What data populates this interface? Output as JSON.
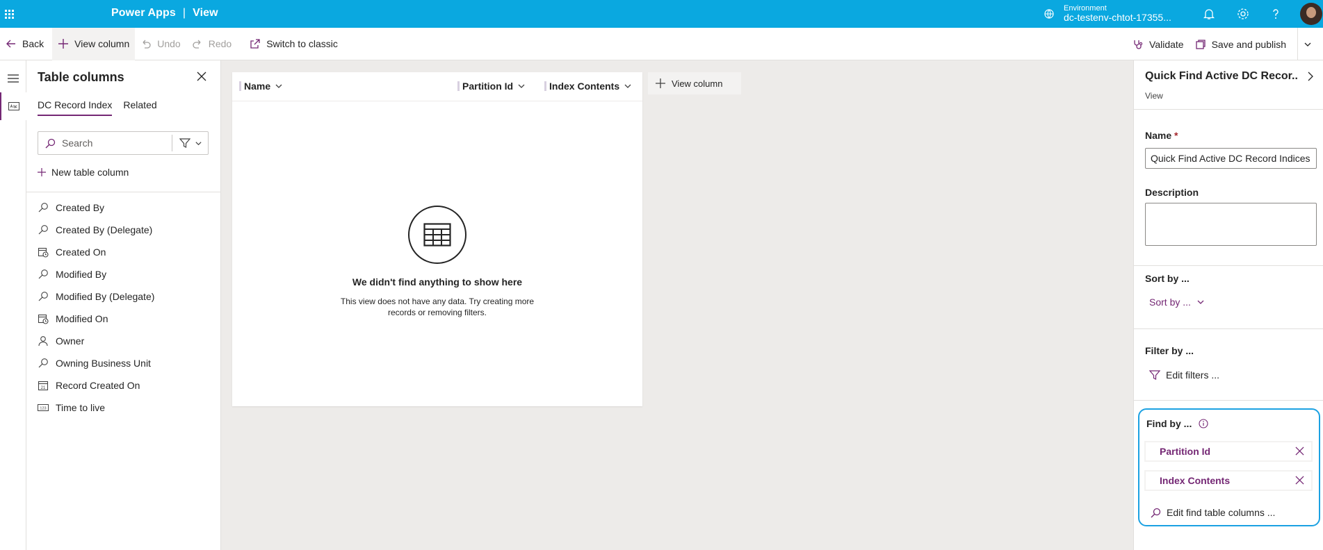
{
  "app": {
    "name": "Power Apps",
    "separator": "|",
    "section": "View",
    "environment_label": "Environment",
    "environment_name": "dc-testenv-chtot-17355..."
  },
  "commands": {
    "back": "Back",
    "view_column": "View column",
    "undo": "Undo",
    "redo": "Redo",
    "switch_classic": "Switch to classic",
    "validate": "Validate",
    "save_publish": "Save and publish"
  },
  "table_columns": {
    "title": "Table columns",
    "tabs": [
      "DC Record Index",
      "Related"
    ],
    "search_placeholder": "Search",
    "new_column": "New table column",
    "items": [
      {
        "label": "Created By",
        "icon": "lookup-icon"
      },
      {
        "label": "Created By (Delegate)",
        "icon": "lookup-icon"
      },
      {
        "label": "Created On",
        "icon": "datetime-icon"
      },
      {
        "label": "Modified By",
        "icon": "lookup-icon"
      },
      {
        "label": "Modified By (Delegate)",
        "icon": "lookup-icon"
      },
      {
        "label": "Modified On",
        "icon": "datetime-icon"
      },
      {
        "label": "Owner",
        "icon": "person-icon"
      },
      {
        "label": "Owning Business Unit",
        "icon": "lookup-icon"
      },
      {
        "label": "Record Created On",
        "icon": "date-icon"
      },
      {
        "label": "Time to live",
        "icon": "number-icon"
      }
    ]
  },
  "grid": {
    "columns": [
      "Name",
      "Partition Id",
      "Index Contents"
    ],
    "add_column": "View column",
    "empty_title": "We didn't find anything to show here",
    "empty_desc_line1": "This view does not have any data. Try creating more",
    "empty_desc_line2": "records or removing filters."
  },
  "properties": {
    "title": "Quick Find Active DC Recor...",
    "subtitle": "View",
    "name_label": "Name",
    "required_mark": "*",
    "name_value": "Quick Find Active DC Record Indices",
    "description_label": "Description",
    "description_value": "",
    "sort_label": "Sort by ...",
    "sort_button": "Sort by ...",
    "filter_label": "Filter by ...",
    "filter_button": "Edit filters ...",
    "find_label": "Find by ...",
    "find_columns": [
      "Partition Id",
      "Index Contents"
    ],
    "find_edit": "Edit find table columns ..."
  },
  "colors": {
    "header": "#0aa8e0",
    "accent": "#742774",
    "highlight": "#1ba1e2"
  }
}
